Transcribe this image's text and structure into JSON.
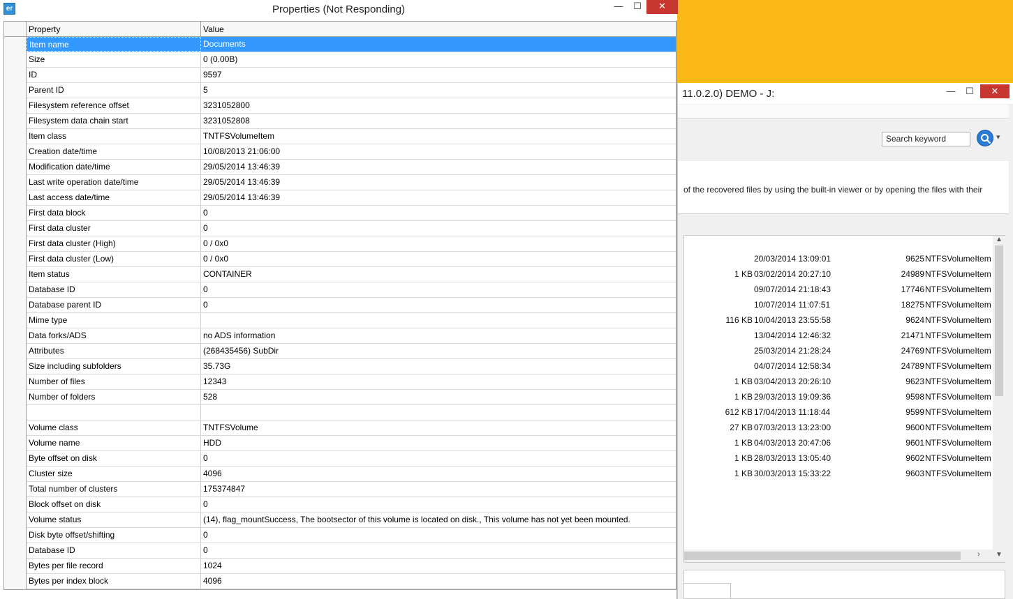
{
  "background_window": {
    "title": "11.0.2.0) DEMO - J:",
    "minimize": "—",
    "maximize": "☐",
    "close": "✕",
    "search_placeholder": "Search keyword",
    "search_arrow": "▾",
    "info_text": "of the recovered files by using the built-in viewer or by opening the files with their",
    "scroll_up": "▲",
    "scroll_down": "▼",
    "scroll_right": "›",
    "rows": [
      {
        "size": "",
        "date": "20/03/2014 13:09:01",
        "id": "9625",
        "class": "NTFSVolumeItem"
      },
      {
        "size": "1 KB",
        "date": "03/02/2014 20:27:10",
        "id": "24989",
        "class": "NTFSVolumeItem"
      },
      {
        "size": "",
        "date": "09/07/2014 21:18:43",
        "id": "17746",
        "class": "NTFSVolumeItem"
      },
      {
        "size": "",
        "date": "10/07/2014 11:07:51",
        "id": "18275",
        "class": "NTFSVolumeItem"
      },
      {
        "size": "116 KB",
        "date": "10/04/2013 23:55:58",
        "id": "9624",
        "class": "NTFSVolumeItem"
      },
      {
        "size": "",
        "date": "13/04/2014 12:46:32",
        "id": "21471",
        "class": "NTFSVolumeItem"
      },
      {
        "size": "",
        "date": "25/03/2014 21:28:24",
        "id": "24769",
        "class": "NTFSVolumeItem"
      },
      {
        "size": "",
        "date": "04/07/2014 12:58:34",
        "id": "24789",
        "class": "NTFSVolumeItem"
      },
      {
        "size": "1 KB",
        "date": "03/04/2013 20:26:10",
        "id": "9623",
        "class": "NTFSVolumeItem"
      },
      {
        "size": "1 KB",
        "date": "29/03/2013 19:09:36",
        "id": "9598",
        "class": "NTFSVolumeItem"
      },
      {
        "size": "612 KB",
        "date": "17/04/2013 11:18:44",
        "id": "9599",
        "class": "NTFSVolumeItem"
      },
      {
        "size": "27 KB",
        "date": "07/03/2013 13:23:00",
        "id": "9600",
        "class": "NTFSVolumeItem"
      },
      {
        "size": "1 KB",
        "date": "04/03/2013 20:47:06",
        "id": "9601",
        "class": "NTFSVolumeItem"
      },
      {
        "size": "1 KB",
        "date": "28/03/2013 13:05:40",
        "id": "9602",
        "class": "NTFSVolumeItem"
      },
      {
        "size": "1 KB",
        "date": "30/03/2013 15:33:22",
        "id": "9603",
        "class": "NTFSVolumeItem"
      }
    ]
  },
  "dialog": {
    "icon_text": "er",
    "title": "Properties (Not Responding)",
    "minimize": "—",
    "maximize": "☐",
    "close": "✕",
    "header": {
      "property": "Property",
      "value": "Value"
    },
    "rows": [
      {
        "property": "Item name",
        "value": "Documents"
      },
      {
        "property": "Size",
        "value": "0 (0.00B)"
      },
      {
        "property": "ID",
        "value": "9597"
      },
      {
        "property": "Parent ID",
        "value": "5"
      },
      {
        "property": "Filesystem reference offset",
        "value": "3231052800"
      },
      {
        "property": "Filesystem data chain start",
        "value": "3231052808"
      },
      {
        "property": "Item class",
        "value": "TNTFSVolumeItem"
      },
      {
        "property": "Creation date/time",
        "value": "10/08/2013 21:06:00"
      },
      {
        "property": "Modification date/time",
        "value": "29/05/2014 13:46:39"
      },
      {
        "property": "Last write operation date/time",
        "value": "29/05/2014 13:46:39"
      },
      {
        "property": "Last access date/time",
        "value": "29/05/2014 13:46:39"
      },
      {
        "property": "First data block",
        "value": "0"
      },
      {
        "property": "First data cluster",
        "value": "0"
      },
      {
        "property": "First data cluster (High)",
        "value": "0 / 0x0"
      },
      {
        "property": "First data cluster (Low)",
        "value": "0 / 0x0"
      },
      {
        "property": "Item status",
        "value": "CONTAINER"
      },
      {
        "property": "Database ID",
        "value": "0"
      },
      {
        "property": "Database parent ID",
        "value": "0"
      },
      {
        "property": "Mime type",
        "value": ""
      },
      {
        "property": "Data forks/ADS",
        "value": "no ADS information"
      },
      {
        "property": "Attributes",
        "value": "(268435456) SubDir"
      },
      {
        "property": "Size including subfolders",
        "value": "35.73G"
      },
      {
        "property": "Number of files",
        "value": "12343"
      },
      {
        "property": "Number of folders",
        "value": "528"
      },
      {
        "property": "",
        "value": ""
      },
      {
        "property": "Volume class",
        "value": "TNTFSVolume"
      },
      {
        "property": "Volume name",
        "value": "HDD"
      },
      {
        "property": "Byte offset on disk",
        "value": "0"
      },
      {
        "property": "Cluster size",
        "value": "4096"
      },
      {
        "property": "Total number of clusters",
        "value": "175374847"
      },
      {
        "property": "Block offset on disk",
        "value": "0"
      },
      {
        "property": "Volume status",
        "value": "(14), flag_mountSuccess, The bootsector of this volume is located on disk., This volume has not yet been mounted."
      },
      {
        "property": "Disk byte offset/shifting",
        "value": "0"
      },
      {
        "property": "Database ID",
        "value": "0"
      },
      {
        "property": "Bytes per file record",
        "value": "1024"
      },
      {
        "property": "Bytes per index block",
        "value": "4096"
      }
    ]
  }
}
